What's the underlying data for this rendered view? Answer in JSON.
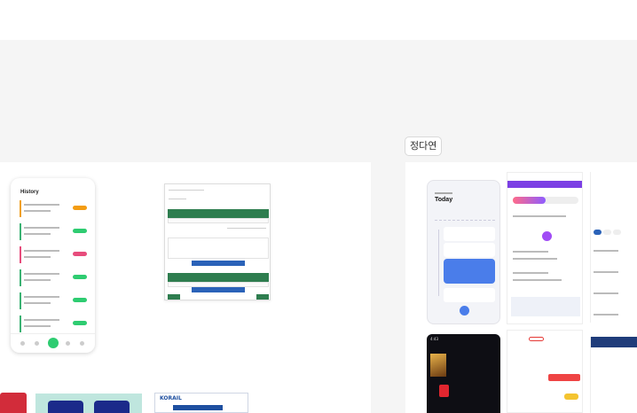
{
  "canvas": {
    "frame_label": "정다연"
  },
  "history_phone": {
    "title": "History"
  },
  "korail_thumb": {
    "logo": "KORAIL"
  },
  "today_phone": {
    "title": "Today"
  },
  "dark_phone": {
    "time": "4:43"
  },
  "colors": {
    "canvas_bg": "#f5f5f5",
    "frame_bg": "#ffffff",
    "accent_green": "#2e7d4f",
    "accent_purple": "#7b3fe4",
    "accent_blue": "#4a7dea",
    "accent_red": "#e1262f"
  }
}
